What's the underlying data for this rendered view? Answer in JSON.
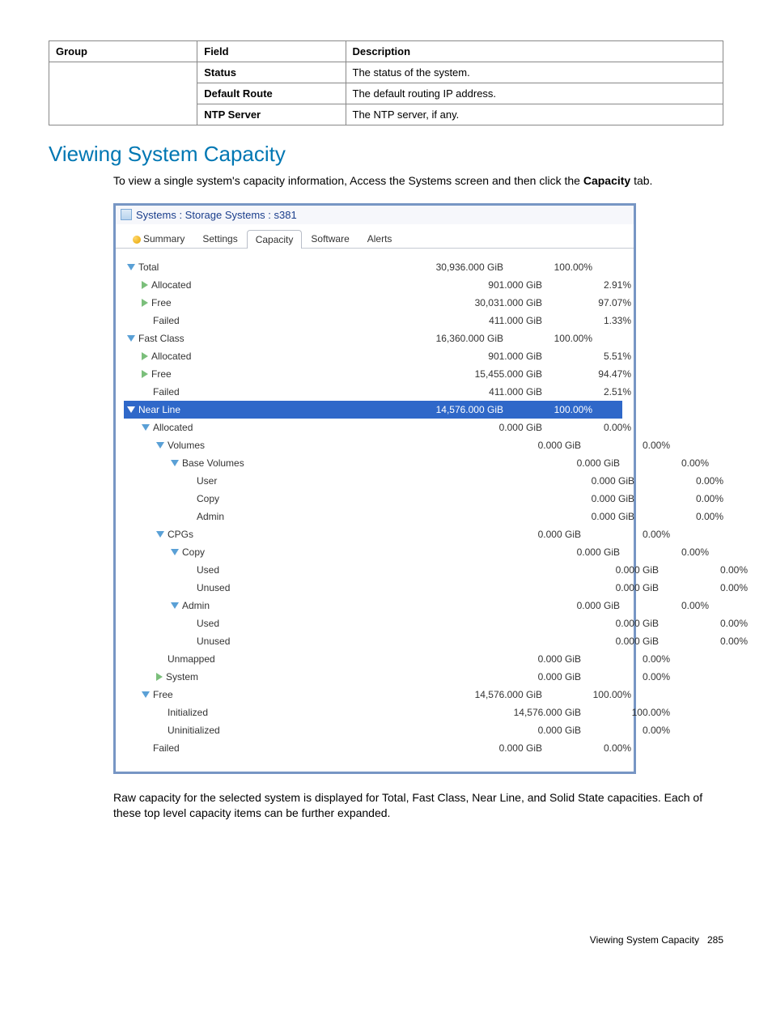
{
  "def_table": {
    "headers": [
      "Group",
      "Field",
      "Description"
    ],
    "rows": [
      {
        "group": "",
        "field": "Status",
        "desc": "The status of the system."
      },
      {
        "group": "",
        "field": "Default Route",
        "desc": "The default routing IP address."
      },
      {
        "group": "",
        "field": "NTP Server",
        "desc": "The NTP server, if any."
      }
    ]
  },
  "heading": "Viewing System Capacity",
  "intro_pre": "To view a single system's capacity information, Access the Systems screen and then click the ",
  "intro_bold": "Capacity",
  "intro_post": " tab.",
  "panel": {
    "breadcrumb": "Systems : Storage Systems : s381",
    "tabs": [
      "Summary",
      "Settings",
      "Capacity",
      "Software",
      "Alerts"
    ],
    "active_tab": 2
  },
  "tree": [
    {
      "label": "Total",
      "gib": "30,936.000 GiB",
      "pct": "100.00%",
      "indent": 0,
      "icon": "down",
      "goff": 0,
      "sel": false
    },
    {
      "label": "Allocated",
      "gib": "901.000 GiB",
      "pct": "2.91%",
      "indent": 1,
      "icon": "right",
      "goff": 1,
      "sel": false
    },
    {
      "label": "Free",
      "gib": "30,031.000 GiB",
      "pct": "97.07%",
      "indent": 1,
      "icon": "right",
      "goff": 1,
      "sel": false
    },
    {
      "label": "Failed",
      "gib": "411.000 GiB",
      "pct": "1.33%",
      "indent": 1,
      "icon": "none",
      "goff": 1,
      "sel": false
    },
    {
      "label": "Fast Class",
      "gib": "16,360.000 GiB",
      "pct": "100.00%",
      "indent": 0,
      "icon": "down",
      "goff": 0,
      "sel": false
    },
    {
      "label": "Allocated",
      "gib": "901.000 GiB",
      "pct": "5.51%",
      "indent": 1,
      "icon": "right",
      "goff": 1,
      "sel": false
    },
    {
      "label": "Free",
      "gib": "15,455.000 GiB",
      "pct": "94.47%",
      "indent": 1,
      "icon": "right",
      "goff": 1,
      "sel": false
    },
    {
      "label": "Failed",
      "gib": "411.000 GiB",
      "pct": "2.51%",
      "indent": 1,
      "icon": "none",
      "goff": 1,
      "sel": false
    },
    {
      "label": "Near Line",
      "gib": "14,576.000 GiB",
      "pct": "100.00%",
      "indent": 0,
      "icon": "down",
      "goff": 0,
      "sel": true
    },
    {
      "label": "Allocated",
      "gib": "0.000 GiB",
      "pct": "0.00%",
      "indent": 1,
      "icon": "down",
      "goff": 1,
      "sel": false
    },
    {
      "label": "Volumes",
      "gib": "0.000 GiB",
      "pct": "0.00%",
      "indent": 2,
      "icon": "down",
      "goff": 2,
      "sel": false
    },
    {
      "label": "Base Volumes",
      "gib": "0.000 GiB",
      "pct": "0.00%",
      "indent": 3,
      "icon": "down",
      "goff": 3,
      "sel": false
    },
    {
      "label": "User",
      "gib": "0.000 GiB",
      "pct": "0.00%",
      "indent": 4,
      "icon": "none",
      "goff": 3,
      "sel": false
    },
    {
      "label": "Copy",
      "gib": "0.000 GiB",
      "pct": "0.00%",
      "indent": 4,
      "icon": "none",
      "goff": 3,
      "sel": false
    },
    {
      "label": "Admin",
      "gib": "0.000 GiB",
      "pct": "0.00%",
      "indent": 4,
      "icon": "none",
      "goff": 3,
      "sel": false
    },
    {
      "label": "CPGs",
      "gib": "0.000 GiB",
      "pct": "0.00%",
      "indent": 2,
      "icon": "down",
      "goff": 2,
      "sel": false
    },
    {
      "label": "Copy",
      "gib": "0.000 GiB",
      "pct": "0.00%",
      "indent": 3,
      "icon": "down",
      "goff": 3,
      "sel": false
    },
    {
      "label": "Used",
      "gib": "0.000 GiB",
      "pct": "0.00%",
      "indent": 4,
      "icon": "none",
      "goff": 4,
      "sel": false
    },
    {
      "label": "Unused",
      "gib": "0.000 GiB",
      "pct": "0.00%",
      "indent": 4,
      "icon": "none",
      "goff": 4,
      "sel": false
    },
    {
      "label": "Admin",
      "gib": "0.000 GiB",
      "pct": "0.00%",
      "indent": 3,
      "icon": "down",
      "goff": 3,
      "sel": false
    },
    {
      "label": "Used",
      "gib": "0.000 GiB",
      "pct": "0.00%",
      "indent": 4,
      "icon": "none",
      "goff": 4,
      "sel": false
    },
    {
      "label": "Unused",
      "gib": "0.000 GiB",
      "pct": "0.00%",
      "indent": 4,
      "icon": "none",
      "goff": 4,
      "sel": false
    },
    {
      "label": "Unmapped",
      "gib": "0.000 GiB",
      "pct": "0.00%",
      "indent": 2,
      "icon": "none",
      "goff": 2,
      "sel": false
    },
    {
      "label": "System",
      "gib": "0.000 GiB",
      "pct": "0.00%",
      "indent": 2,
      "icon": "right",
      "goff": 2,
      "sel": false
    },
    {
      "label": "Free",
      "gib": "14,576.000 GiB",
      "pct": "100.00%",
      "indent": 1,
      "icon": "down",
      "goff": 1,
      "sel": false
    },
    {
      "label": "Initialized",
      "gib": "14,576.000 GiB",
      "pct": "100.00%",
      "indent": 2,
      "icon": "none",
      "goff": 2,
      "sel": false
    },
    {
      "label": "Uninitialized",
      "gib": "0.000 GiB",
      "pct": "0.00%",
      "indent": 2,
      "icon": "none",
      "goff": 2,
      "sel": false
    },
    {
      "label": "Failed",
      "gib": "0.000 GiB",
      "pct": "0.00%",
      "indent": 1,
      "icon": "none",
      "goff": 1,
      "sel": false
    }
  ],
  "outro": "Raw capacity for the selected system is displayed for Total, Fast Class, Near Line, and Solid State capacities. Each of these top level capacity items can be further expanded.",
  "footer_label": "Viewing System Capacity",
  "footer_page": "285"
}
